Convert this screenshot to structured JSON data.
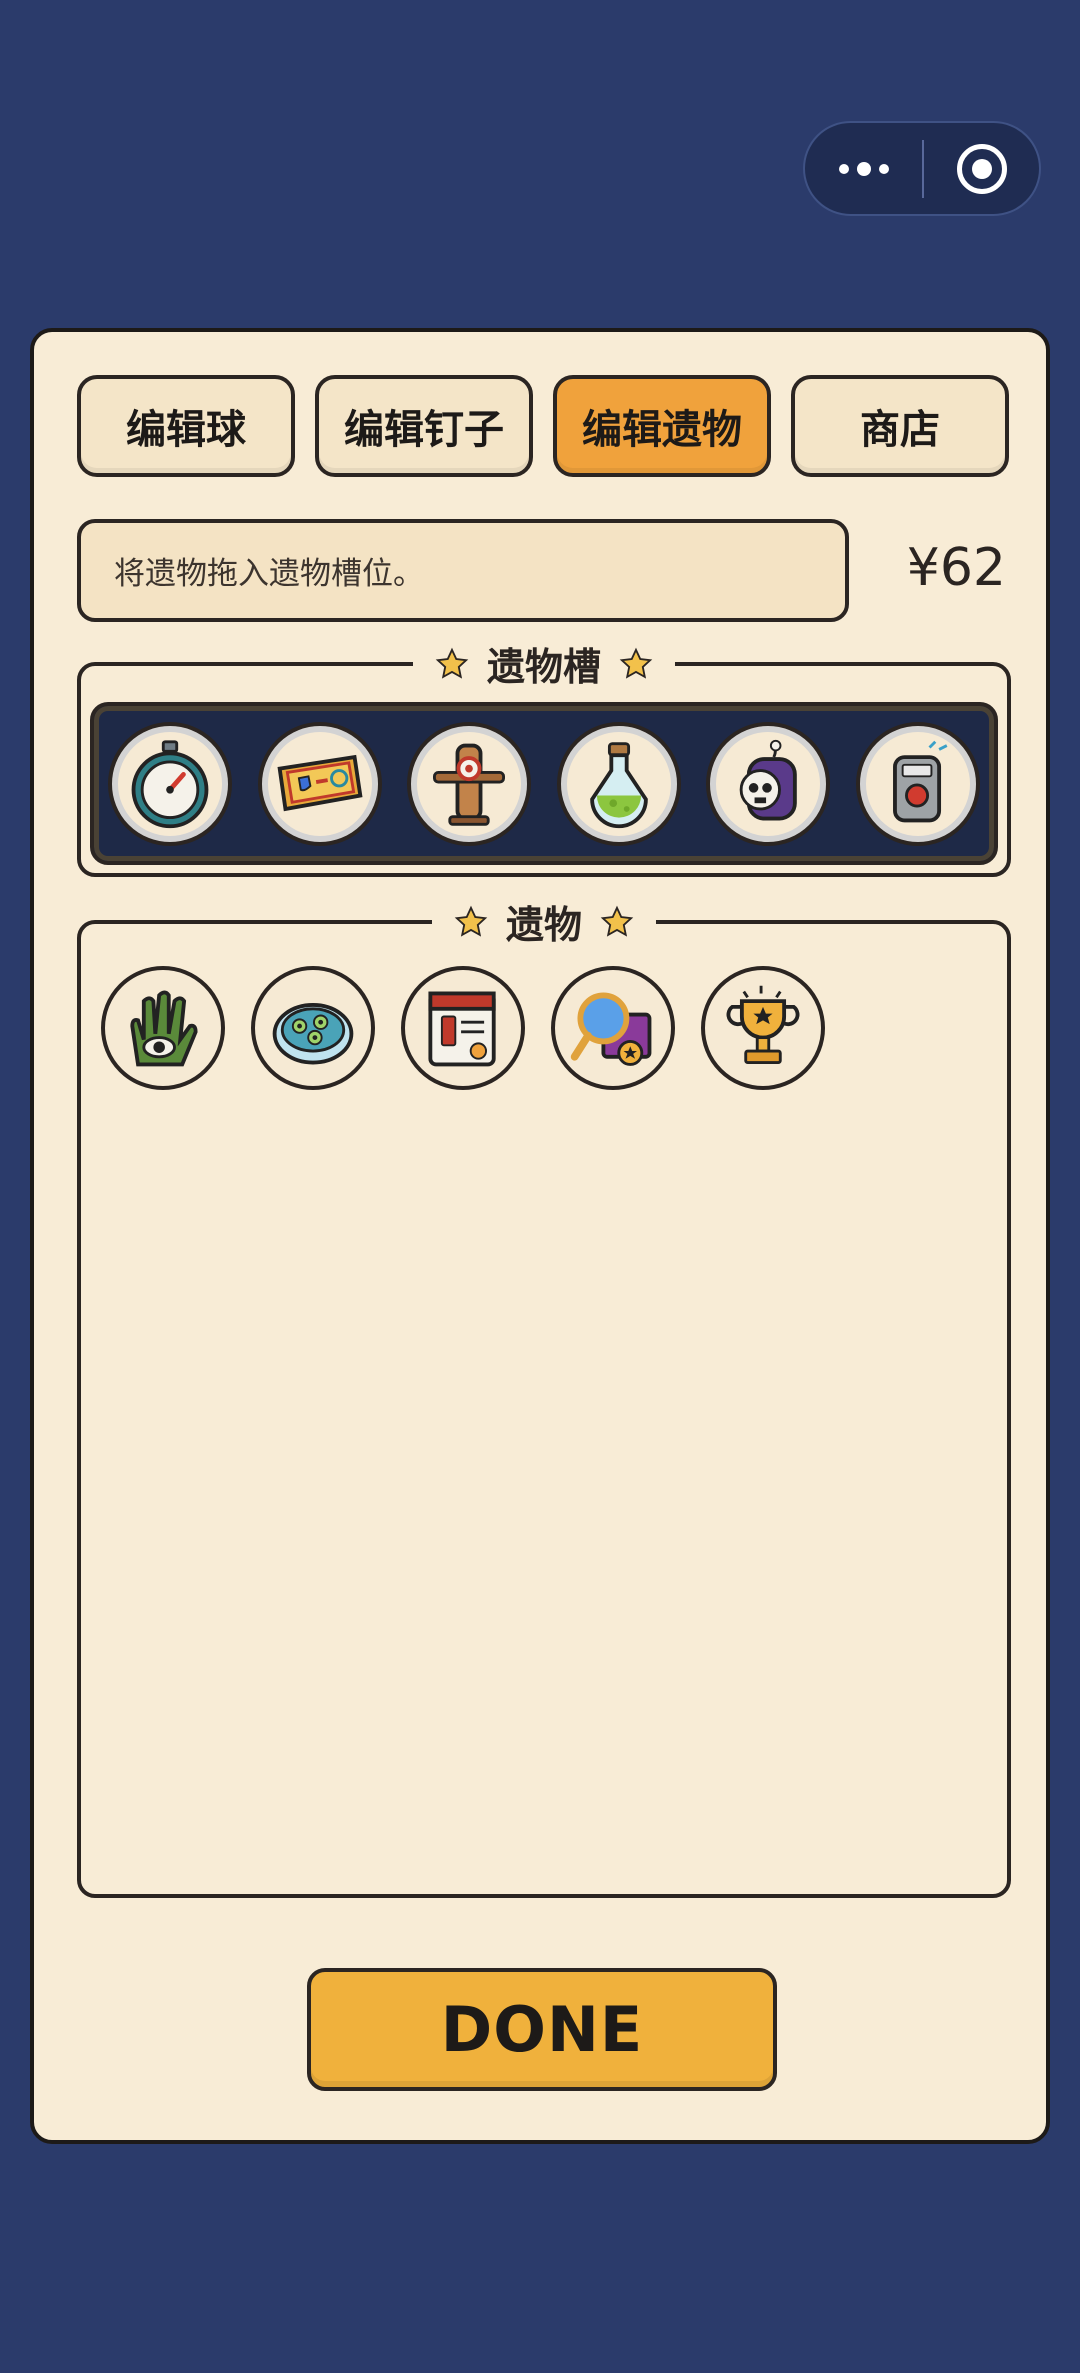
{
  "capsule": {
    "more_icon": "more-dots-icon",
    "close_icon": "target-close-icon"
  },
  "tabs": [
    {
      "label": "编辑球",
      "active": false
    },
    {
      "label": "编辑钉子",
      "active": false
    },
    {
      "label": "编辑遗物",
      "active": true
    },
    {
      "label": "商店",
      "active": false
    }
  ],
  "hint": "将遗物拖入遗物槽位。",
  "money": "¥62",
  "slots": {
    "title": "遗物槽",
    "items": [
      "stopwatch-icon",
      "ticket-icon",
      "training-dummy-icon",
      "potion-icon",
      "skull-bomb-icon",
      "detonator-icon"
    ]
  },
  "inventory": {
    "title": "遗物",
    "items": [
      "hand-eye-icon",
      "petri-dish-icon",
      "warning-card-icon",
      "magnifier-icon",
      "trophy-icon"
    ]
  },
  "done_label": "DONE",
  "colors": {
    "background": "#2b3b6b",
    "panel": "#f8ecd6",
    "active_tab": "#f0a23c",
    "done_button": "#f0b13c",
    "slot_bar": "#1e2947"
  }
}
